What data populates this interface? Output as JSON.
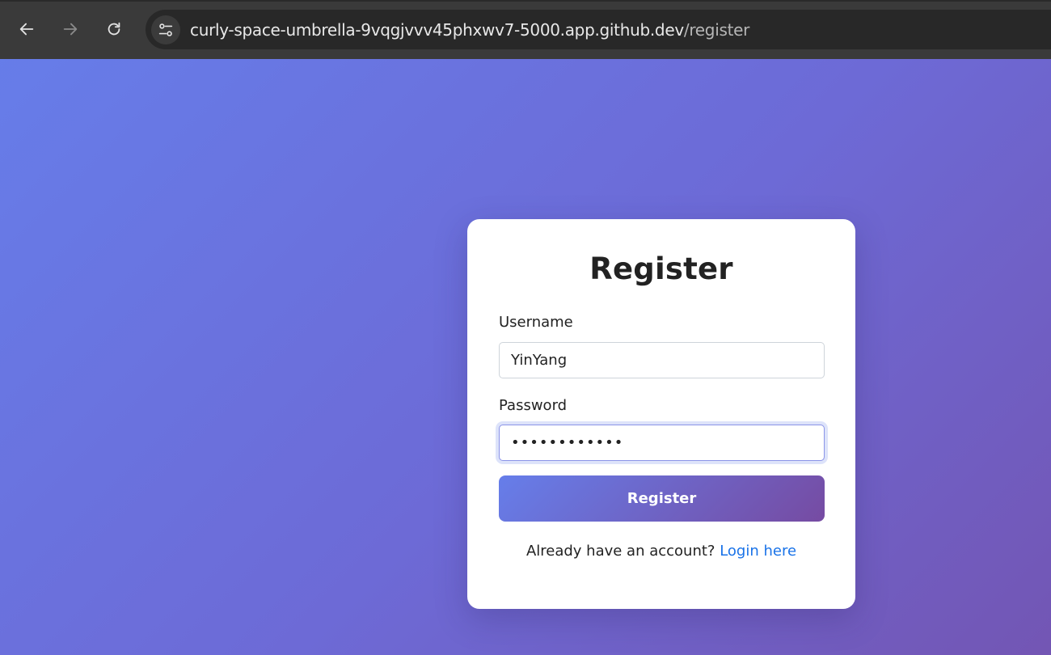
{
  "browser": {
    "url_host": "curly-space-umbrella-9vqgjvvv45phxwv7-5000.app.github.dev",
    "url_path": "/register",
    "icons": [
      "back-arrow-icon",
      "forward-arrow-icon",
      "reload-icon",
      "site-settings-icon"
    ]
  },
  "colors": {
    "gradient_start": "#667eea",
    "gradient_end": "#764ba2",
    "link": "#1a73e8"
  },
  "form": {
    "title": "Register",
    "username_label": "Username",
    "username_value": "YinYang",
    "password_label": "Password",
    "password_value": "••••••••••••",
    "submit_label": "Register",
    "footer_text": "Already have an account? ",
    "login_link": "Login here"
  }
}
